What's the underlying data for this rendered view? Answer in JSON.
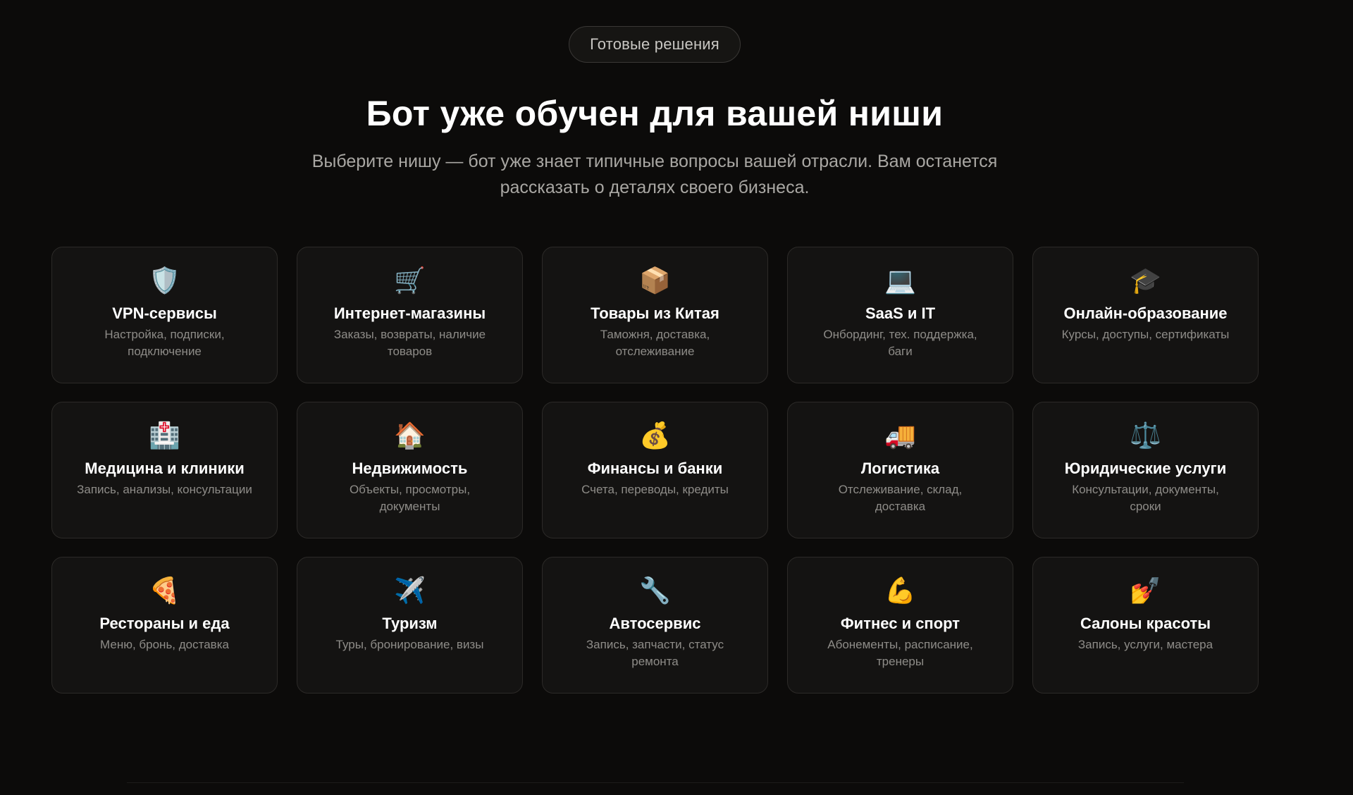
{
  "badge": "Готовые решения",
  "heading": "Бот уже обучен для вашей ниши",
  "subheading": "Выберите нишу — бот уже знает типичные вопросы вашей отрасли. Вам останется рассказать о деталях своего бизнеса.",
  "cards": [
    {
      "icon": "🛡️",
      "icon_name": "shield-icon",
      "title": "VPN-сервисы",
      "desc": "Настройка, подписки, подключение"
    },
    {
      "icon": "🛒",
      "icon_name": "shopping-cart-icon",
      "title": "Интернет-магазины",
      "desc": "Заказы, возвраты, наличие товаров"
    },
    {
      "icon": "📦",
      "icon_name": "package-icon",
      "title": "Товары из Китая",
      "desc": "Таможня, доставка, отслеживание"
    },
    {
      "icon": "💻",
      "icon_name": "laptop-icon",
      "title": "SaaS и IT",
      "desc": "Онбординг, тех. поддержка, баги"
    },
    {
      "icon": "🎓",
      "icon_name": "graduation-cap-icon",
      "title": "Онлайн-образование",
      "desc": "Курсы, доступы, сертификаты"
    },
    {
      "icon": "🏥",
      "icon_name": "hospital-icon",
      "title": "Медицина и клиники",
      "desc": "Запись, анализы, консультации"
    },
    {
      "icon": "🏠",
      "icon_name": "house-icon",
      "title": "Недвижимость",
      "desc": "Объекты, просмотры, документы"
    },
    {
      "icon": "💰",
      "icon_name": "money-bag-icon",
      "title": "Финансы и банки",
      "desc": "Счета, переводы, кредиты"
    },
    {
      "icon": "🚚",
      "icon_name": "delivery-truck-icon",
      "title": "Логистика",
      "desc": "Отслеживание, склад, доставка"
    },
    {
      "icon": "⚖️",
      "icon_name": "scales-icon",
      "title": "Юридические услуги",
      "desc": "Консультации, документы, сроки"
    },
    {
      "icon": "🍕",
      "icon_name": "pizza-icon",
      "title": "Рестораны и еда",
      "desc": "Меню, бронь, доставка"
    },
    {
      "icon": "✈️",
      "icon_name": "airplane-icon",
      "title": "Туризм",
      "desc": "Туры, бронирование, визы"
    },
    {
      "icon": "🔧",
      "icon_name": "wrench-icon",
      "title": "Автосервис",
      "desc": "Запись, запчасти, статус ремонта"
    },
    {
      "icon": "💪",
      "icon_name": "flexed-biceps-icon",
      "title": "Фитнес и спорт",
      "desc": "Абонементы, расписание, тренеры"
    },
    {
      "icon": "💅",
      "icon_name": "nail-polish-icon",
      "title": "Салоны красоты",
      "desc": "Запись, услуги, мастера"
    }
  ]
}
